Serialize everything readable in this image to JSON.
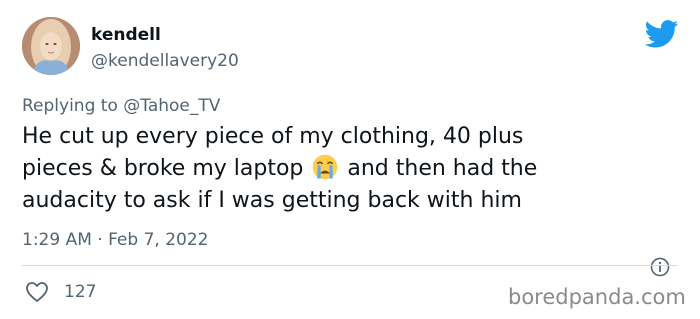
{
  "author": {
    "display_name": "kendell",
    "handle": "@kendellavery20"
  },
  "reply": {
    "prefix": "Replying to ",
    "mention": "@Tahoe_TV"
  },
  "tweet": {
    "line1": "He cut up every piece of my clothing, 40 plus",
    "line2_before_emoji": "pieces & broke my laptop ",
    "emoji_name": "loudly-crying-face-icon",
    "line2_after_emoji": " and then had the",
    "line3": "audacity to ask if I was getting back with him"
  },
  "meta": {
    "timestamp": "1:29 AM · Feb 7, 2022"
  },
  "actions": {
    "like_count": "127"
  },
  "watermark": "boredpanda.com",
  "colors": {
    "twitter_blue": "#1d9bf0",
    "text_primary": "#0f1419",
    "text_secondary": "#536471",
    "divider": "#cfd9de"
  }
}
